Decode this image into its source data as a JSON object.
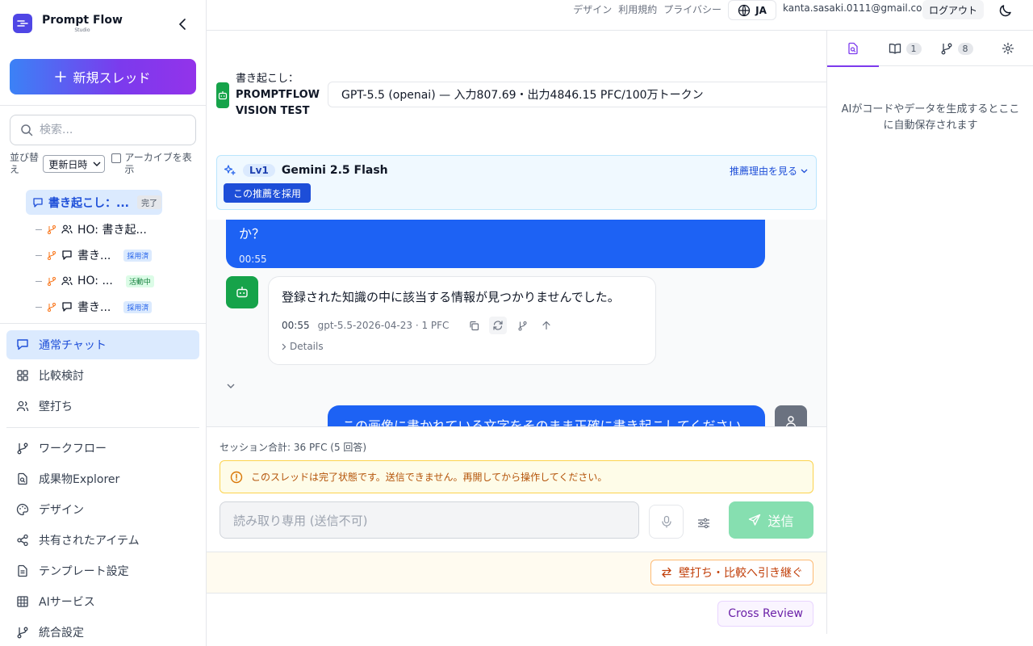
{
  "brand": {
    "name": "Prompt Flow",
    "sub": "Studio"
  },
  "sidebar": {
    "new_thread_label": "新規スレッド",
    "search_placeholder": "検索...",
    "sort_label": "並び替え",
    "sort_value": "更新日時",
    "archive_label": "アーカイブを表示",
    "active_thread": {
      "label": "書き起こし：...",
      "badge": "完了"
    },
    "children": [
      {
        "label": "HO: 書き起...",
        "badge": ""
      },
      {
        "label": "書き...",
        "badge": "採用済"
      },
      {
        "label": "HO: ...",
        "badge": "活動中"
      },
      {
        "label": "書き...",
        "badge": "採用済"
      }
    ],
    "nav": [
      {
        "label": "通常チャット"
      },
      {
        "label": "比較検討"
      },
      {
        "label": "壁打ち"
      },
      {
        "label": "ワークフロー"
      },
      {
        "label": "成果物Explorer"
      },
      {
        "label": "デザイン"
      },
      {
        "label": "共有されたアイテム"
      },
      {
        "label": "テンプレート設定"
      },
      {
        "label": "AIサービス"
      },
      {
        "label": "統合設定"
      }
    ]
  },
  "topbar": {
    "links": [
      "デザイン",
      "利用規約",
      "プライバシー"
    ],
    "lang": "JA",
    "email": "kanta.sasaki.0111@gmail.com",
    "logout": "ログアウト"
  },
  "thread": {
    "title_prefix": "書き起こし：",
    "title_main": "PROMPTFLOW VISION TEST",
    "model": "GPT-5.5 (openai) — 入力807.69・出力4846.15 PFC/100万トークン"
  },
  "recommendation": {
    "level": "Lv1",
    "model": "Gemini 2.5 Flash",
    "reason_link": "推薦理由を見る",
    "adopt_label": "この推薦を採用"
  },
  "messages": {
    "user1_text": "か？",
    "user1_time": "00:55",
    "bot_text": "登録された知識の中に該当する情報が見つかりませんでした。",
    "bot_time": "00:55",
    "bot_meta": "gpt-5.5-2026-04-23 · 1 PFC",
    "details": "Details",
    "user2_text": "この画像に書かれている文字をそのまま正確に書き起こしてください"
  },
  "composer": {
    "session_total": "セッション合計: 36 PFC (5 回答)",
    "warning": "このスレッドは完了状態です。送信できません。再開してから操作してください。",
    "input_placeholder": "読み取り専用 (送信不可)",
    "send_label": "送信",
    "handover_label": "壁打ち・比較へ引き継ぐ",
    "cross_review_label": "Cross Review"
  },
  "right_panel": {
    "tab_counts": [
      "1",
      "8"
    ],
    "empty_text": "AIがコードやデータを生成するとここに自動保存されます"
  },
  "colors": {
    "accent": "#1d62f4",
    "brand": "#4f46e5",
    "success": "#16a34a",
    "send_disabled": "#86dfb0"
  }
}
